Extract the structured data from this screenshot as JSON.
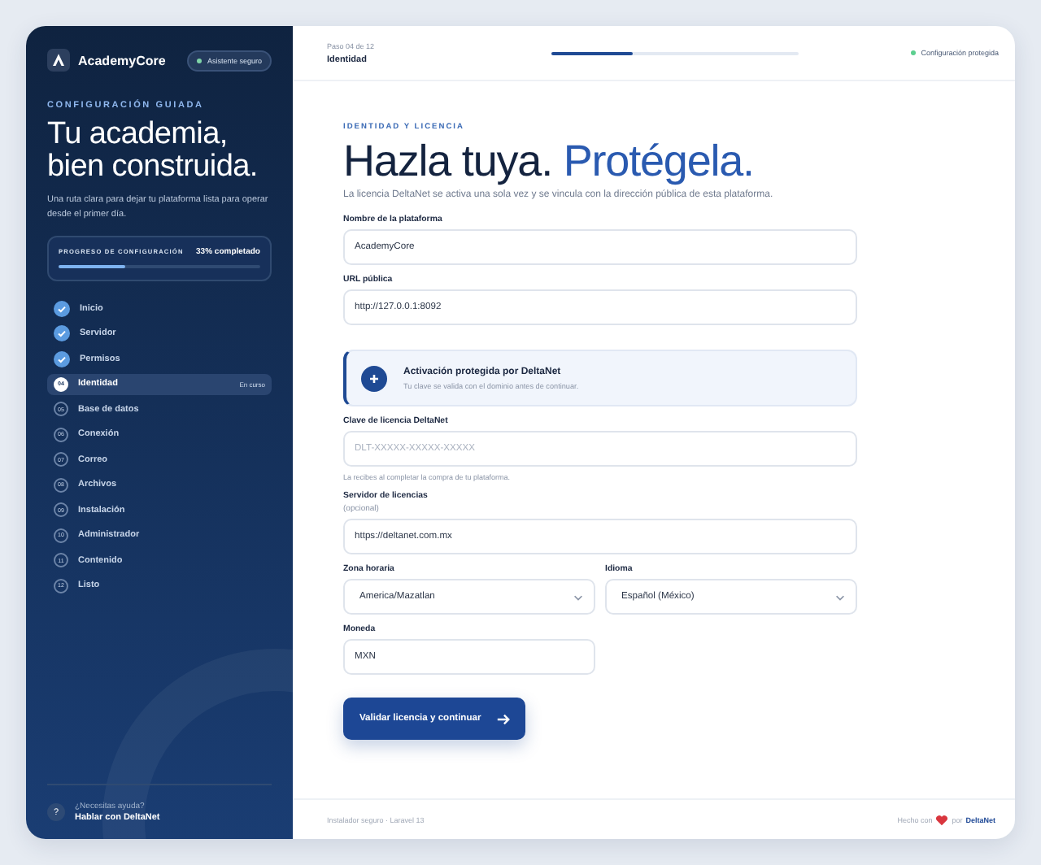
{
  "sidebar": {
    "brand": "AcademyCore",
    "badge": "Asistente seguro",
    "eyebrow": "CONFIGURACIÓN GUIADA",
    "title": "Tu academia, bien construida.",
    "description": "Una ruta clara para dejar tu plataforma lista para operar desde el primer día.",
    "progress": {
      "label": "PROGRESO DE CONFIGURACIÓN",
      "reading": "33% completado",
      "level": 0.33
    },
    "steps": [
      {
        "label": "Inicio",
        "kind": "done"
      },
      {
        "label": "Servidor",
        "kind": "done"
      },
      {
        "label": "Permisos",
        "kind": "done"
      },
      {
        "number": "04",
        "label": "Identidad",
        "kind": "current",
        "tag": "En curso"
      },
      {
        "number": "05",
        "label": "Base de datos",
        "kind": "pending"
      },
      {
        "number": "06",
        "label": "Conexión",
        "kind": "pending"
      },
      {
        "number": "07",
        "label": "Correo",
        "kind": "pending"
      },
      {
        "number": "08",
        "label": "Archivos",
        "kind": "pending"
      },
      {
        "number": "09",
        "label": "Instalación",
        "kind": "pending"
      },
      {
        "number": "10",
        "label": "Administrador",
        "kind": "pending"
      },
      {
        "number": "11",
        "label": "Contenido",
        "kind": "pending"
      },
      {
        "number": "12",
        "label": "Listo",
        "kind": "pending"
      }
    ],
    "help": {
      "icon": "?",
      "question": "¿Necesitas ayuda?",
      "link": "Hablar con DeltaNet"
    }
  },
  "topbar": {
    "step": "Paso 04 de 12",
    "title": "Identidad",
    "level": 0.33,
    "status": "Configuración protegida"
  },
  "main": {
    "eyebrow": "IDENTIDAD Y LICENCIA",
    "title": "Hazla tuya.",
    "title_accent": "Protégela.",
    "description": "La licencia DeltaNet se activa una sola vez y se vincula con la dirección pública de esta plataforma.",
    "fields": [
      {
        "kind": "input",
        "label": "Nombre de la plataforma",
        "value": "AcademyCore"
      },
      {
        "kind": "input",
        "label": "URL pública",
        "value": "http://127.0.0.1:8092"
      },
      {
        "kind": "notice",
        "title": "Activación protegida por DeltaNet",
        "text": "Tu clave se valida con el dominio antes de continuar."
      },
      {
        "kind": "input",
        "label": "Clave de licencia DeltaNet",
        "placeholder": "DLT-XXXXX-XXXXX-XXXXX",
        "hint": "La recibes al completar la compra de tu plataforma."
      },
      {
        "kind": "input",
        "label": "Servidor de licencias",
        "note": "(opcional)",
        "value": "https://deltanet.com.mx"
      },
      {
        "kind": "selects",
        "items": [
          {
            "label": "Zona horaria",
            "value": "America/Mazatlan"
          },
          {
            "label": "Idioma",
            "value": "Español (México)"
          }
        ]
      },
      {
        "kind": "half",
        "label": "Moneda",
        "value": "MXN"
      }
    ],
    "button": "Validar licencia y continuar"
  },
  "footer": {
    "left": "Instalador seguro · Laravel 13",
    "made": "Hecho con",
    "by": "por",
    "brand": "DeltaNet"
  }
}
